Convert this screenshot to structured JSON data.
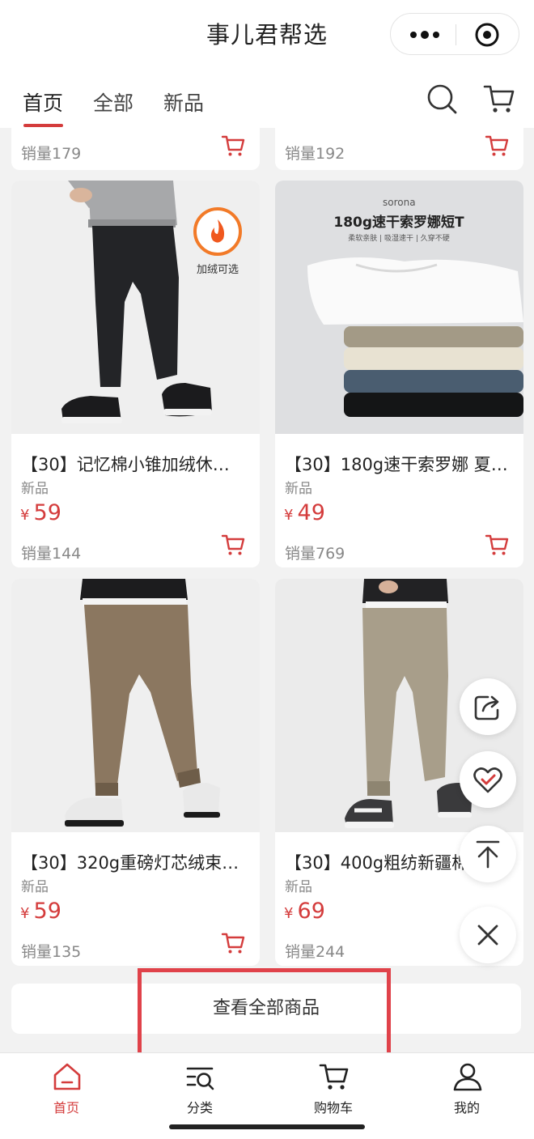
{
  "app": {
    "title": "事儿君帮选"
  },
  "tabs": [
    {
      "label": "首页",
      "active": true
    },
    {
      "label": "全部",
      "active": false
    },
    {
      "label": "新品",
      "active": false
    }
  ],
  "top_row": [
    {
      "sales": "销量179"
    },
    {
      "sales": "销量192"
    }
  ],
  "products": [
    {
      "name": "【30】记忆棉小锥加绒休…",
      "tag": "新品",
      "currency": "¥",
      "price": "59",
      "sales": "销量144",
      "image_label": "加绒可选"
    },
    {
      "name": "【30】180g速干索罗娜 夏…",
      "tag": "新品",
      "currency": "¥",
      "price": "49",
      "sales": "销量769",
      "image_brand": "sorona",
      "image_title": "180g速干索罗娜短T",
      "image_subtitle": "柔软亲肤 | 吸湿速干 | 久穿不硬"
    },
    {
      "name": "【30】320g重磅灯芯绒束…",
      "tag": "新品",
      "currency": "¥",
      "price": "59",
      "sales": "销量135"
    },
    {
      "name": "【30】400g粗纺新疆棉",
      "tag": "新品",
      "currency": "¥",
      "price": "69",
      "sales": "销量244"
    }
  ],
  "view_all": {
    "label": "查看全部商品"
  },
  "bottom_nav": [
    {
      "label": "首页",
      "icon": "home-icon",
      "active": true
    },
    {
      "label": "分类",
      "icon": "category-icon",
      "active": false
    },
    {
      "label": "购物车",
      "icon": "cart-icon",
      "active": false
    },
    {
      "label": "我的",
      "icon": "user-icon",
      "active": false
    }
  ],
  "colors": {
    "accent": "#d43c3c",
    "highlight_box": "#e0424a"
  }
}
